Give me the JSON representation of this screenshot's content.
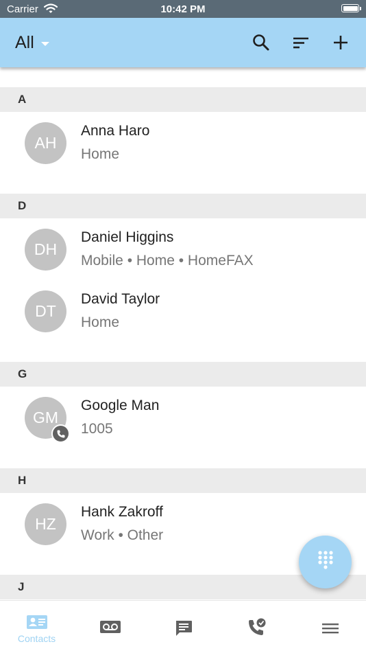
{
  "status_bar": {
    "carrier": "Carrier",
    "time": "10:42 PM"
  },
  "app_bar": {
    "filter_label": "All"
  },
  "sections": [
    {
      "letter": "A",
      "contacts": [
        {
          "initials": "AH",
          "name": "Anna Haro",
          "detail": "Home"
        }
      ]
    },
    {
      "letter": "D",
      "contacts": [
        {
          "initials": "DH",
          "name": "Daniel Higgins",
          "detail": "Mobile • Home • HomeFAX"
        },
        {
          "initials": "DT",
          "name": "David Taylor",
          "detail": "Home"
        }
      ]
    },
    {
      "letter": "G",
      "contacts": [
        {
          "initials": "GM",
          "name": "Google Man",
          "detail": "1005",
          "badge_icon": "phone-icon"
        }
      ]
    },
    {
      "letter": "H",
      "contacts": [
        {
          "initials": "HZ",
          "name": "Hank Zakroff",
          "detail": "Work • Other"
        }
      ]
    },
    {
      "letter": "J",
      "contacts": []
    }
  ],
  "bottom_nav": {
    "items": [
      {
        "icon": "contacts-icon",
        "label": "Contacts",
        "active": true
      },
      {
        "icon": "voicemail-icon"
      },
      {
        "icon": "message-icon"
      },
      {
        "icon": "call-history-icon"
      },
      {
        "icon": "menu-icon"
      }
    ]
  },
  "colors": {
    "accent": "#a5d6f5",
    "status_bar": "#5a6a76",
    "avatar": "#c3c3c3",
    "section_bg": "#ebebeb"
  }
}
